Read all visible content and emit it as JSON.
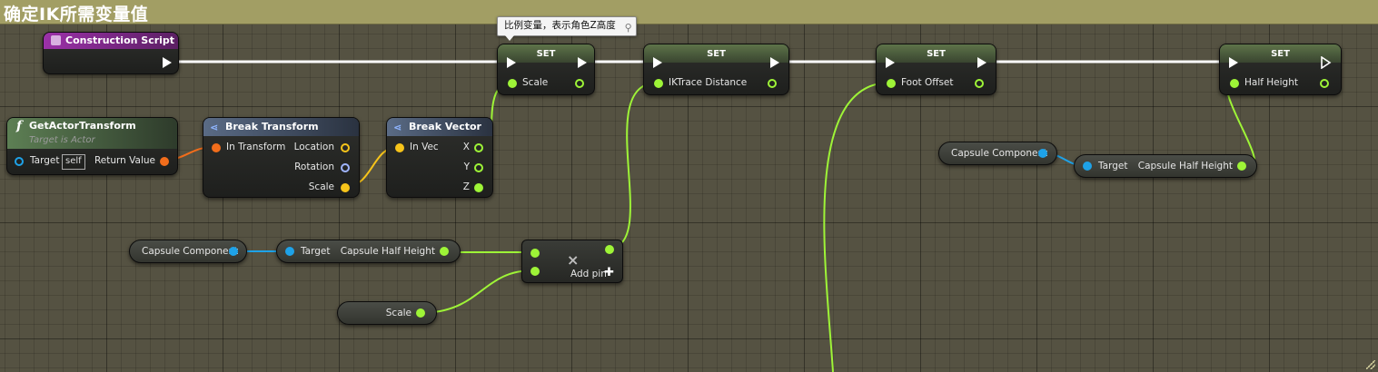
{
  "comment": {
    "title": "确定IK所需变量值",
    "color": "#a29e64"
  },
  "tooltip": {
    "text": "比例变量，表示角色Z高度",
    "icon": "pin-icon"
  },
  "colors": {
    "exec": "#ffffff",
    "float": "#9ef437",
    "vector": "#f7c41a",
    "transform": "#f26d1b",
    "rotator": "#9fb4ff",
    "object": "#1ea2e8",
    "set_header": "#5a6e47",
    "event_header": "#8e2b9a",
    "function_header": "#4e6b4a",
    "struct_header": "#47546b"
  },
  "nodes": {
    "construction_script": {
      "title": "Construction Script",
      "icon": "event-icon"
    },
    "get_actor_transform": {
      "title": "GetActorTransform",
      "subtitle": "Target is Actor",
      "icon": "function-icon",
      "target_label": "Target",
      "self_label": "self",
      "return_label": "Return Value"
    },
    "break_transform": {
      "title": "Break Transform",
      "icon": "struct-icon",
      "in_label": "In Transform",
      "outputs": [
        "Location",
        "Rotation",
        "Scale"
      ]
    },
    "break_vector": {
      "title": "Break Vector",
      "icon": "struct-icon",
      "in_label": "In Vec",
      "outputs": [
        "X",
        "Y",
        "Z"
      ]
    },
    "set_scale": {
      "title": "SET",
      "var_label": "Scale"
    },
    "set_iktrace": {
      "title": "SET",
      "var_label": "IKTrace Distance"
    },
    "set_foot_offset": {
      "title": "SET",
      "var_label": "Foot Offset"
    },
    "set_half_height": {
      "title": "SET",
      "var_label": "Half Height"
    },
    "capsule_component_1": {
      "label": "Capsule Component"
    },
    "get_half_height_1": {
      "target_label": "Target",
      "out_label": "Capsule Half Height"
    },
    "capsule_component_2": {
      "label": "Capsule Component"
    },
    "get_half_height_2": {
      "target_label": "Target",
      "out_label": "Capsule Half Height"
    },
    "scale_var": {
      "label": "Scale"
    },
    "multiply": {
      "symbol": "×",
      "add_pin_label": "Add pin",
      "add_icon": "plus-icon"
    }
  }
}
